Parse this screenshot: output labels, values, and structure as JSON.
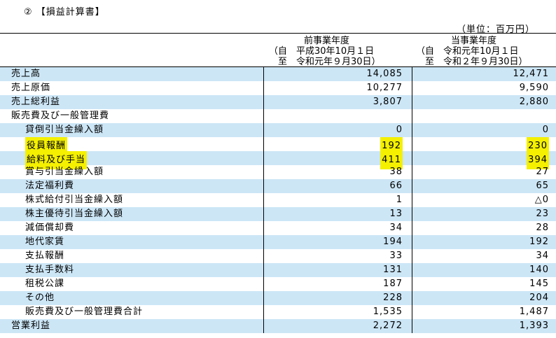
{
  "title": "② 【損益計算書】",
  "unit": "（単位：百万円）",
  "columns": [
    {
      "heading": "前事業年度",
      "period_from": "（自　平成30年10月１日",
      "period_to": "　至　令和元年９月30日）"
    },
    {
      "heading": "当事業年度",
      "period_from": "（自　令和元年10月１日",
      "period_to": "　至　令和２年９月30日）"
    }
  ],
  "rows": [
    {
      "label": "売上高",
      "prev": "14,085",
      "curr": "12,471",
      "indent": 0,
      "shaded": true,
      "highlight": false
    },
    {
      "label": "売上原価",
      "prev": "10,277",
      "curr": "9,590",
      "indent": 0,
      "shaded": false,
      "highlight": false
    },
    {
      "label": "売上総利益",
      "prev": "3,807",
      "curr": "2,880",
      "indent": 0,
      "shaded": true,
      "highlight": false
    },
    {
      "label": "販売費及び一般管理費",
      "prev": "",
      "curr": "",
      "indent": 0,
      "shaded": false,
      "highlight": false
    },
    {
      "label": "貸倒引当金繰入額",
      "prev": "0",
      "curr": "0",
      "indent": 1,
      "shaded": true,
      "highlight": false
    },
    {
      "label": "役員報酬",
      "prev": "192",
      "curr": "230",
      "indent": 1,
      "shaded": false,
      "highlight": true
    },
    {
      "label": "給料及び手当",
      "prev": "411",
      "curr": "394",
      "indent": 1,
      "shaded": true,
      "highlight": true
    },
    {
      "label": "賞与引当金繰入額",
      "prev": "38",
      "curr": "27",
      "indent": 1,
      "shaded": false,
      "highlight": false
    },
    {
      "label": "法定福利費",
      "prev": "66",
      "curr": "65",
      "indent": 1,
      "shaded": true,
      "highlight": false
    },
    {
      "label": "株式給付引当金繰入額",
      "prev": "1",
      "curr": "△0",
      "indent": 1,
      "shaded": false,
      "highlight": false
    },
    {
      "label": "株主優待引当金繰入額",
      "prev": "13",
      "curr": "23",
      "indent": 1,
      "shaded": true,
      "highlight": false
    },
    {
      "label": "減価償却費",
      "prev": "34",
      "curr": "28",
      "indent": 1,
      "shaded": false,
      "highlight": false
    },
    {
      "label": "地代家賃",
      "prev": "194",
      "curr": "192",
      "indent": 1,
      "shaded": true,
      "highlight": false
    },
    {
      "label": "支払報酬",
      "prev": "33",
      "curr": "34",
      "indent": 1,
      "shaded": false,
      "highlight": false
    },
    {
      "label": "支払手数料",
      "prev": "131",
      "curr": "140",
      "indent": 1,
      "shaded": true,
      "highlight": false
    },
    {
      "label": "租税公課",
      "prev": "187",
      "curr": "145",
      "indent": 1,
      "shaded": false,
      "highlight": false
    },
    {
      "label": "その他",
      "prev": "228",
      "curr": "204",
      "indent": 1,
      "shaded": true,
      "highlight": false
    },
    {
      "label": "販売費及び一般管理費合計",
      "prev": "1,535",
      "curr": "1,487",
      "indent": 1,
      "shaded": false,
      "highlight": false
    },
    {
      "label": "営業利益",
      "prev": "2,272",
      "curr": "1,393",
      "indent": 0,
      "shaded": true,
      "highlight": false
    }
  ],
  "colors": {
    "shade": "#cce6f6",
    "highlight": "#f4f000",
    "rule": "#000000"
  }
}
